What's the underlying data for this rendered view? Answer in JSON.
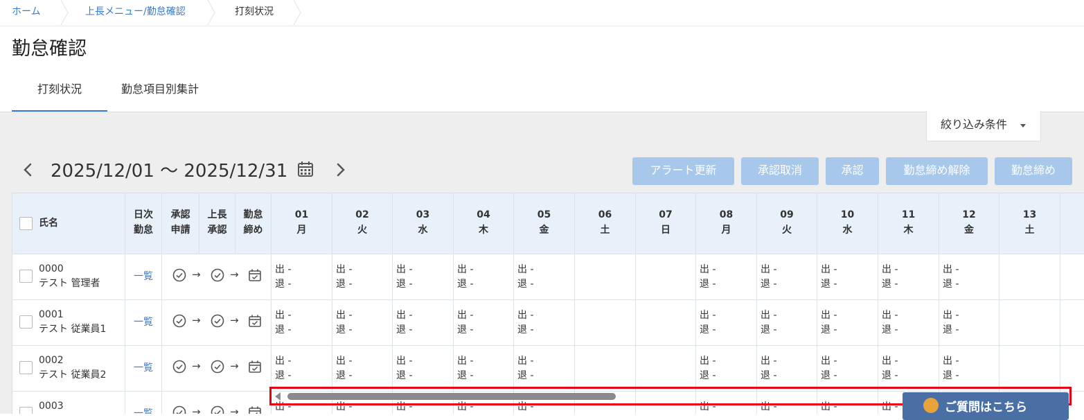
{
  "breadcrumb": [
    {
      "label": "ホーム"
    },
    {
      "label": "上長メニュー/勤怠確認"
    },
    {
      "label": "打刻状況"
    }
  ],
  "page_title": "勤怠確認",
  "tabs": [
    {
      "label": "打刻状況",
      "active": true
    },
    {
      "label": "勤怠項目別集計",
      "active": false
    }
  ],
  "filter": {
    "label": "絞り込み条件"
  },
  "period": {
    "range": "2025/12/01 ～ 2025/12/31"
  },
  "actions": [
    {
      "label": "アラート更新",
      "enabled": false
    },
    {
      "label": "承認取消",
      "enabled": false
    },
    {
      "label": "承認",
      "enabled": false
    },
    {
      "label": "勤怠締め解除",
      "enabled": false
    },
    {
      "label": "勤怠締め",
      "enabled": false
    }
  ],
  "table": {
    "headers": {
      "name": "氏名",
      "daily": [
        "日次",
        "勤怠"
      ],
      "approval_request": [
        "承認",
        "申請"
      ],
      "manager_approval": [
        "上長",
        "承認"
      ],
      "closing": [
        "勤怠",
        "締め"
      ]
    },
    "days": [
      {
        "day": "01",
        "dow": "月",
        "workday": true
      },
      {
        "day": "02",
        "dow": "火",
        "workday": true
      },
      {
        "day": "03",
        "dow": "水",
        "workday": true
      },
      {
        "day": "04",
        "dow": "木",
        "workday": true
      },
      {
        "day": "05",
        "dow": "金",
        "workday": true
      },
      {
        "day": "06",
        "dow": "土",
        "workday": false
      },
      {
        "day": "07",
        "dow": "日",
        "workday": false
      },
      {
        "day": "08",
        "dow": "月",
        "workday": true
      },
      {
        "day": "09",
        "dow": "火",
        "workday": true
      },
      {
        "day": "10",
        "dow": "水",
        "workday": true
      },
      {
        "day": "11",
        "dow": "木",
        "workday": true
      },
      {
        "day": "12",
        "dow": "金",
        "workday": true
      },
      {
        "day": "13",
        "dow": "土",
        "workday": false
      }
    ],
    "employees": [
      {
        "code": "0000",
        "name": "テスト 管理者"
      },
      {
        "code": "0001",
        "name": "テスト 従業員1"
      },
      {
        "code": "0002",
        "name": "テスト 従業員2"
      },
      {
        "code": "0003",
        "name": ""
      }
    ],
    "list_link": "一覧",
    "clock_in": "出 -",
    "clock_out": "退 -"
  },
  "help": {
    "label": "ご質問はこちら"
  },
  "icons": {
    "prev": "chevron-left-icon",
    "next": "chevron-right-icon",
    "calendar": "calendar-icon",
    "status": "check-circle-icon",
    "closing": "calendar-check-icon",
    "help": "person-icon"
  },
  "colors": {
    "link": "#3a7bc8",
    "button_disabled": "#a7c8ea",
    "header_bg": "#e8f0f9",
    "page_bg": "#eeeeee",
    "highlight": "#e60012",
    "help_bg": "#4a6fa5"
  }
}
